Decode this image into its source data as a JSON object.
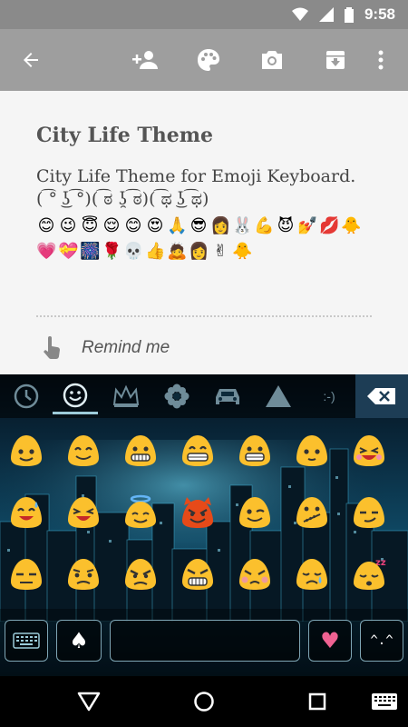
{
  "status_bar": {
    "time": "9:58",
    "icons": [
      "wifi-icon",
      "cell-signal-icon",
      "battery-icon"
    ]
  },
  "toolbar": {
    "icons": [
      "back-arrow-icon",
      "add-person-icon",
      "palette-icon",
      "camera-icon",
      "archive-icon",
      "overflow-menu-icon"
    ]
  },
  "note": {
    "title": "City Life Theme",
    "body_line1": "City Life Theme for Emoji Keyboard.",
    "body_line2": "( ͡° ͜ʖ ͡°)( ͡ಠ ʖ̯ ͡ಠ)( ͡ಥ ͜ʖ ͡ಥ)",
    "emoji_row1": [
      "😊",
      "😉",
      "😇",
      "😌",
      "😊",
      "😍",
      "🙏",
      "😎",
      "👩",
      "🐰",
      "💪",
      "😈",
      "💅",
      "💋",
      "🐥"
    ],
    "emoji_row2": [
      "💗",
      "💝",
      "🎆",
      "🌹",
      "💀",
      "👍",
      "🙇",
      "👩",
      "✌",
      "🐥"
    ],
    "remind_label": "Remind me"
  },
  "keyboard": {
    "tabs": [
      "recent-clock-icon",
      "smiley-icon",
      "crown-icon",
      "flower-icon",
      "car-icon",
      "triangle-icon"
    ],
    "tab_text": ":-)",
    "active_tab": 1,
    "emoji_faces": [
      "smile",
      "grin",
      "beam",
      "grin-big",
      "laugh",
      "smile-small",
      "laugh-blush",
      "sweat-smile",
      "laugh-squint",
      "halo",
      "devil",
      "wink",
      "zipper",
      "smirk",
      "unamused",
      "confused",
      "angry",
      "grimace",
      "pout",
      "sad",
      "sleepy"
    ],
    "bottom_keys": {
      "spade": "♠",
      "heart": "♥",
      "emoticon": "^.^"
    }
  }
}
